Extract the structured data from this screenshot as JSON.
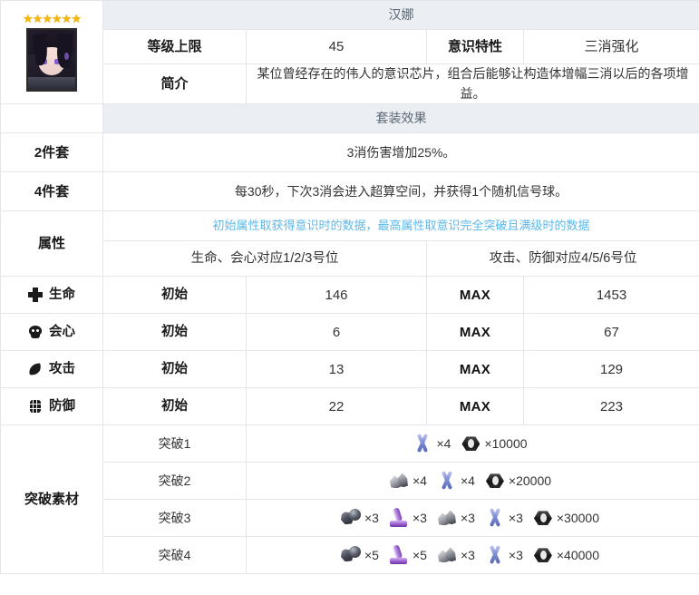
{
  "character": {
    "name": "汉娜",
    "rarity": 6,
    "star_glyph": "★",
    "portrait_alt": "character-portrait"
  },
  "info": {
    "level_cap_label": "等级上限",
    "level_cap_value": "45",
    "trait_label": "意识特性",
    "trait_value": "三消强化",
    "desc_label": "简介",
    "desc_value": "某位曾经存在的伟人的意识芯片，组合后能够让构造体增幅三消以后的各项增益。"
  },
  "set_effect": {
    "header": "套装效果",
    "rows": [
      {
        "label": "2件套",
        "text": "3消伤害增加25%。"
      },
      {
        "label": "4件套",
        "text": "每30秒，下次3消会进入超算空间，并获得1个随机信号球。"
      }
    ]
  },
  "attributes": {
    "label": "属性",
    "note": "初始属性取获得意识时的数据，最高属性取意识完全突破且满级时的数据",
    "col_left_header": "生命、会心对应1/2/3号位",
    "col_right_header": "攻击、防御对应4/5/6号位",
    "initial_label": "初始",
    "max_label": "MAX",
    "stats": [
      {
        "icon": "hp-icon",
        "name": "生命",
        "initial": "146",
        "max": "1453"
      },
      {
        "icon": "crit-icon",
        "name": "会心",
        "initial": "6",
        "max": "67"
      },
      {
        "icon": "atk-icon",
        "name": "攻击",
        "initial": "13",
        "max": "129"
      },
      {
        "icon": "def-icon",
        "name": "防御",
        "initial": "22",
        "max": "223"
      }
    ]
  },
  "breakthrough": {
    "label": "突破素材",
    "rows": [
      {
        "stage": "突破1",
        "materials": [
          {
            "icon": "blue-cross-material-icon",
            "qty": "×4"
          },
          {
            "icon": "black-nut-currency-icon",
            "qty": "×10000"
          }
        ]
      },
      {
        "stage": "突破2",
        "materials": [
          {
            "icon": "white-rock-material-icon",
            "qty": "×4"
          },
          {
            "icon": "blue-cross-material-icon",
            "qty": "×4"
          },
          {
            "icon": "black-nut-currency-icon",
            "qty": "×20000"
          }
        ]
      },
      {
        "stage": "突破3",
        "materials": [
          {
            "icon": "dark-machine-part-icon",
            "qty": "×3"
          },
          {
            "icon": "purple-cylinder-icon",
            "qty": "×3"
          },
          {
            "icon": "white-rock-material-icon",
            "qty": "×3"
          },
          {
            "icon": "blue-cross-material-icon",
            "qty": "×3"
          },
          {
            "icon": "black-nut-currency-icon",
            "qty": "×30000"
          }
        ]
      },
      {
        "stage": "突破4",
        "materials": [
          {
            "icon": "dark-machine-part-icon",
            "qty": "×5"
          },
          {
            "icon": "purple-cylinder-icon",
            "qty": "×5"
          },
          {
            "icon": "white-rock-material-icon",
            "qty": "×3"
          },
          {
            "icon": "blue-cross-material-icon",
            "qty": "×3"
          },
          {
            "icon": "black-nut-currency-icon",
            "qty": "×40000"
          }
        ]
      }
    ]
  },
  "colors": {
    "header_band": "#ebeff3",
    "note_blue": "#5bb8ea",
    "star_gold": "#f5b60d",
    "border": "#e3e6ea"
  }
}
